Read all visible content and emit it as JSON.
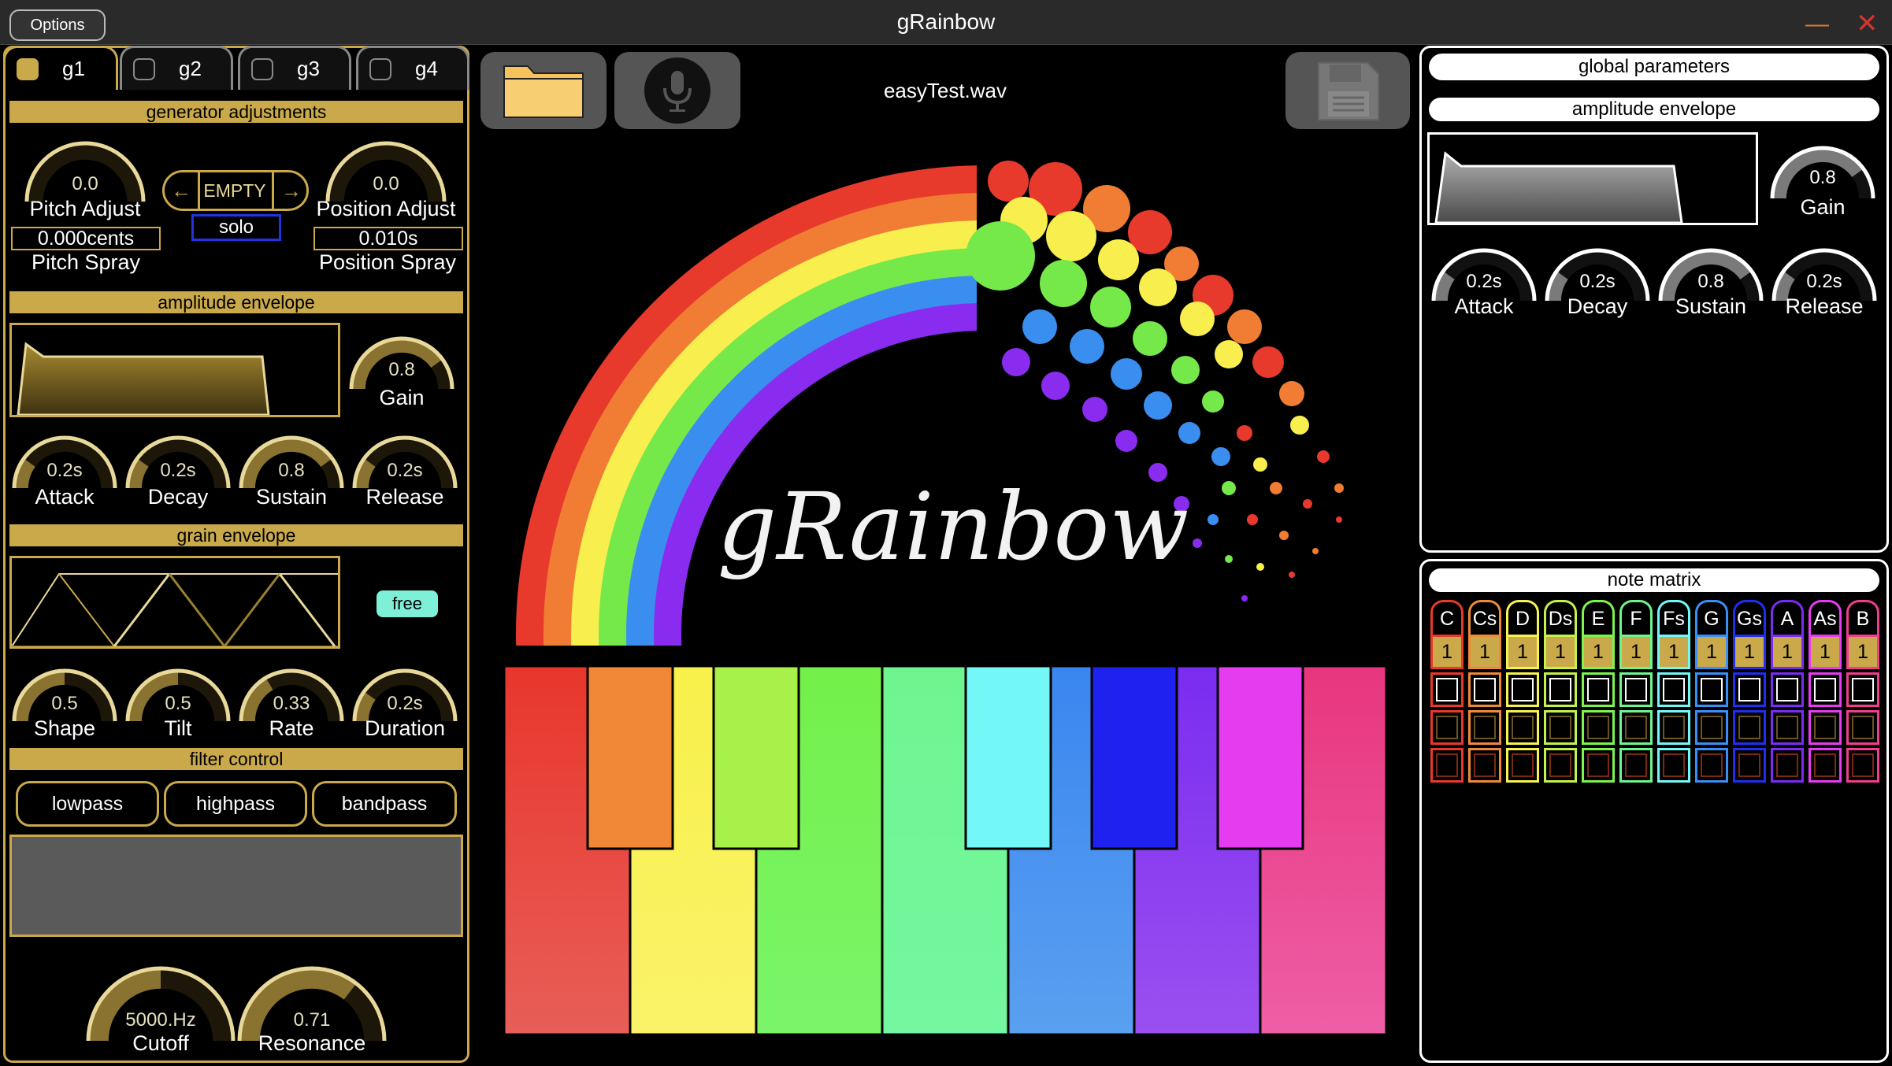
{
  "window": {
    "title": "gRainbow",
    "options_label": "Options",
    "minimize": "—",
    "close": "✕"
  },
  "tabs": [
    {
      "label": "g1",
      "active": true
    },
    {
      "label": "g2"
    },
    {
      "label": "g3"
    },
    {
      "label": "g4"
    }
  ],
  "generator": {
    "header": "generator adjustments",
    "pitch_adjust": {
      "value": "0.0",
      "label": "Pitch Adjust",
      "level": 0.0
    },
    "position_adjust": {
      "value": "0.0",
      "label": "Position Adjust",
      "level": 0.0
    },
    "selector": {
      "label": "EMPTY",
      "left_arrow": "←",
      "right_arrow": "→"
    },
    "solo_label": "solo",
    "pitch_spray": {
      "value": "0.000cents",
      "label": "Pitch Spray"
    },
    "position_spray": {
      "value": "0.010s",
      "label": "Position Spray"
    }
  },
  "amp_env": {
    "header": "amplitude envelope",
    "gain": {
      "value": "0.8",
      "label": "Gain",
      "level": 0.8
    },
    "attack": {
      "value": "0.2s",
      "label": "Attack",
      "level": 0.2
    },
    "decay": {
      "value": "0.2s",
      "label": "Decay",
      "level": 0.2
    },
    "sustain": {
      "value": "0.8",
      "label": "Sustain",
      "level": 0.8
    },
    "release": {
      "value": "0.2s",
      "label": "Release",
      "level": 0.2
    }
  },
  "grain_env": {
    "header": "grain envelope",
    "free_label": "free",
    "shape": {
      "value": "0.5",
      "label": "Shape",
      "level": 0.5
    },
    "tilt": {
      "value": "0.5",
      "label": "Tilt",
      "level": 0.5
    },
    "rate": {
      "value": "0.33",
      "label": "Rate",
      "level": 0.33
    },
    "duration": {
      "value": "0.2s",
      "label": "Duration",
      "level": 0.2
    }
  },
  "filter": {
    "header": "filter control",
    "types": [
      "lowpass",
      "highpass",
      "bandpass"
    ],
    "cutoff": {
      "value": "5000.Hz",
      "label": "Cutoff",
      "level": 0.5
    },
    "resonance": {
      "value": "0.71",
      "label": "Resonance",
      "level": 0.71
    }
  },
  "center": {
    "filename": "easyTest.wav",
    "logo": "gRainbow",
    "icons": [
      "folder-icon",
      "microphone-icon",
      "save-icon"
    ]
  },
  "global": {
    "header": "global parameters",
    "amp_header": "amplitude envelope",
    "gain": {
      "value": "0.8",
      "label": "Gain",
      "level": 0.8
    },
    "attack": {
      "value": "0.2s",
      "label": "Attack",
      "level": 0.2
    },
    "decay": {
      "value": "0.2s",
      "label": "Decay",
      "level": 0.2
    },
    "sustain": {
      "value": "0.8",
      "label": "Sustain",
      "level": 0.8
    },
    "release": {
      "value": "0.2s",
      "label": "Release",
      "level": 0.2
    }
  },
  "note_matrix": {
    "header": "note matrix",
    "notes": [
      "C",
      "Cs",
      "D",
      "Ds",
      "E",
      "F",
      "Fs",
      "G",
      "Gs",
      "A",
      "As",
      "B"
    ],
    "colors": [
      "#e8392b",
      "#ee8a3a",
      "#f6f24e",
      "#c4f24c",
      "#7af54e",
      "#6ef58e",
      "#74f7f7",
      "#3a8ef5",
      "#1f2ff0",
      "#7b2cf2",
      "#e63cf0",
      "#ee3e8c"
    ],
    "first_row_value": "1"
  },
  "colors": {
    "accent_gold": "#c9a94a",
    "panel_white": "#ffffff"
  }
}
